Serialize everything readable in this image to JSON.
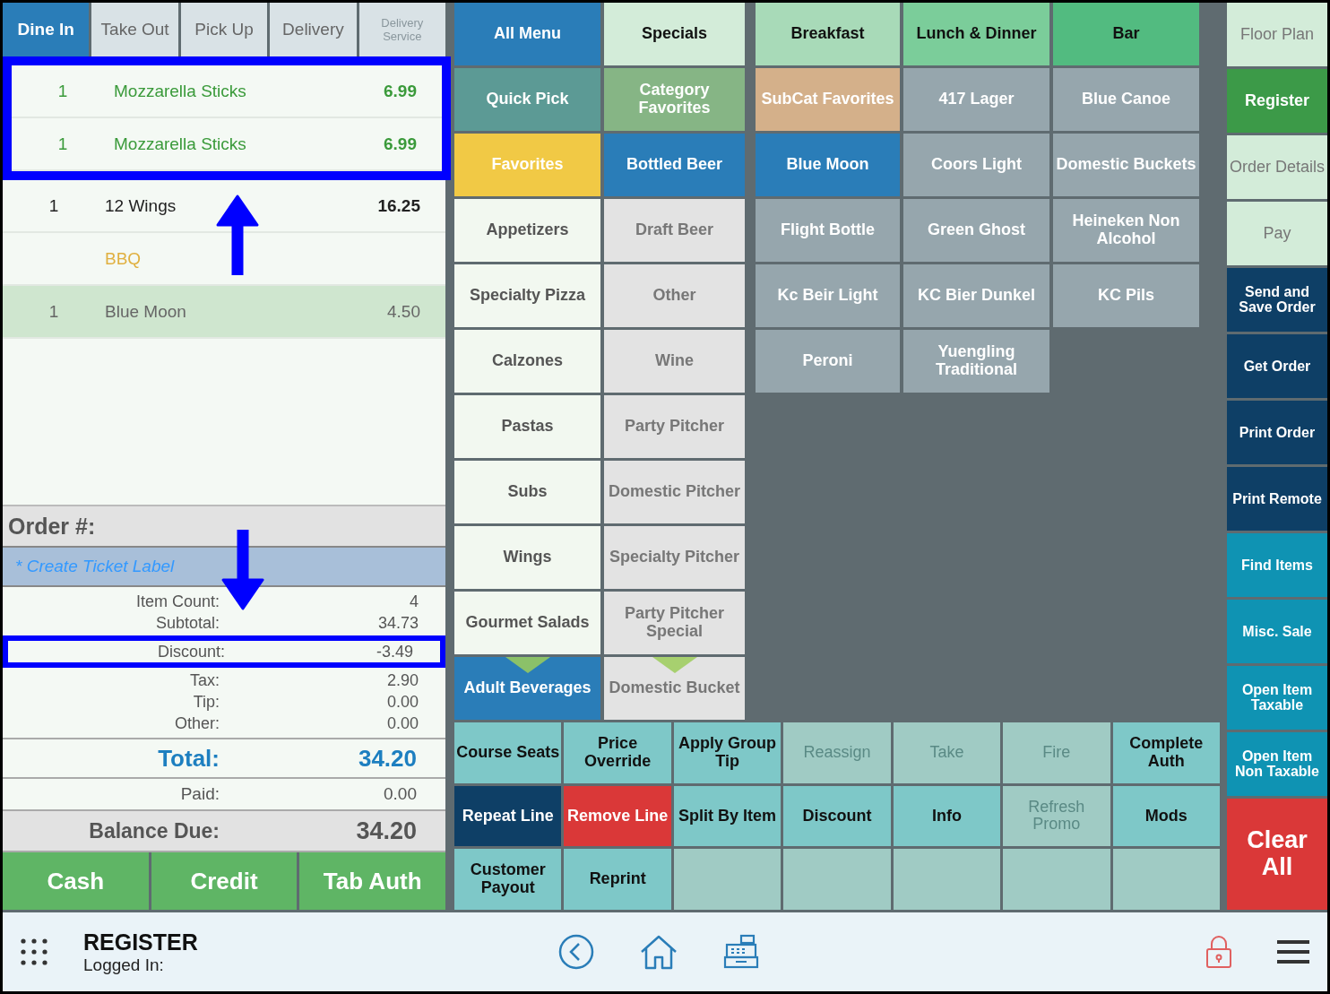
{
  "order_types": [
    {
      "label": "Dine In",
      "selected": true,
      "disabled": false
    },
    {
      "label": "Take Out",
      "selected": false,
      "disabled": false
    },
    {
      "label": "Pick Up",
      "selected": false,
      "disabled": false
    },
    {
      "label": "Delivery",
      "selected": false,
      "disabled": false
    },
    {
      "label": "Delivery Service",
      "selected": false,
      "disabled": true
    }
  ],
  "order_lines": [
    {
      "qty": "1",
      "name": "Mozzarella Sticks",
      "price": "6.99",
      "kind": "sent",
      "selected": false,
      "highlighted": true
    },
    {
      "qty": "1",
      "name": "Mozzarella Sticks",
      "price": "6.99",
      "kind": "sent",
      "selected": false,
      "highlighted": true
    },
    {
      "qty": "1",
      "name": "12 Wings",
      "price": "16.25",
      "kind": "new",
      "selected": false,
      "highlighted": false
    },
    {
      "name": "BBQ",
      "kind": "modifier",
      "selected": false,
      "highlighted": false
    },
    {
      "qty": "1",
      "name": "Blue Moon",
      "price": "4.50",
      "kind": "new",
      "selected": true,
      "highlighted": false
    }
  ],
  "order_number_label": "Order #:",
  "ticket_label": "* Create Ticket Label",
  "summary": [
    {
      "label": "Item Count:",
      "value": "4",
      "highlighted": false
    },
    {
      "label": "Subtotal:",
      "value": "34.73",
      "highlighted": false
    },
    {
      "label": "Discount:",
      "value": "-3.49",
      "highlighted": true
    },
    {
      "label": "Tax:",
      "value": "2.90",
      "highlighted": false
    },
    {
      "label": "Tip:",
      "value": "0.00",
      "highlighted": false
    },
    {
      "label": "Other:",
      "value": "0.00",
      "highlighted": false
    }
  ],
  "total": {
    "label": "Total:",
    "value": "34.20"
  },
  "paid": {
    "label": "Paid:",
    "value": "0.00"
  },
  "balance_due": {
    "label": "Balance Due:",
    "value": "34.20"
  },
  "payment_buttons": [
    "Cash",
    "Credit",
    "Tab Auth"
  ],
  "annotation_arrows": [
    {
      "kind": "up"
    },
    {
      "kind": "down"
    }
  ],
  "menu_tabs": [
    {
      "label": "All Menu",
      "color": "#2a7db8",
      "selected": true
    },
    {
      "label": "Specials",
      "color": "#d3ecd9",
      "selected": false
    },
    {
      "label": "Breakfast",
      "color": "#a8dab8",
      "selected": false
    },
    {
      "label": "Lunch & Dinner",
      "color": "#7bcd9a",
      "selected": false
    },
    {
      "label": "Bar",
      "color": "#52bb80",
      "selected": false
    }
  ],
  "categories": [
    {
      "label": "Quick Pick",
      "kind": "shortcut",
      "selected": false,
      "more_below": false
    },
    {
      "label": "Favorites",
      "kind": "favorite",
      "selected": false,
      "more_below": false
    },
    {
      "label": "Appetizers",
      "kind": "category",
      "selected": false,
      "more_below": false
    },
    {
      "label": "Specialty Pizza",
      "kind": "category",
      "selected": false,
      "more_below": false
    },
    {
      "label": "Calzones",
      "kind": "category",
      "selected": false,
      "more_below": false
    },
    {
      "label": "Pastas",
      "kind": "category",
      "selected": false,
      "more_below": false
    },
    {
      "label": "Subs",
      "kind": "category",
      "selected": false,
      "more_below": false
    },
    {
      "label": "Wings",
      "kind": "category",
      "selected": false,
      "more_below": false
    },
    {
      "label": "Gourmet Salads",
      "kind": "category",
      "selected": false,
      "more_below": false
    },
    {
      "label": "Adult Beverages",
      "kind": "category",
      "selected": true,
      "more_below": true
    }
  ],
  "subcategories": [
    {
      "label": "Category Favorites",
      "kind": "group",
      "selected": false,
      "more_below": false
    },
    {
      "label": "Bottled Beer",
      "kind": "subcategory",
      "selected": true,
      "more_below": false
    },
    {
      "label": "Draft Beer",
      "kind": "subcategory",
      "selected": false,
      "more_below": false
    },
    {
      "label": "Other",
      "kind": "subcategory",
      "selected": false,
      "more_below": false
    },
    {
      "label": "Wine",
      "kind": "subcategory",
      "selected": false,
      "more_below": false
    },
    {
      "label": "Party Pitcher",
      "kind": "subcategory",
      "selected": false,
      "more_below": false
    },
    {
      "label": "Domestic Pitcher",
      "kind": "subcategory",
      "selected": false,
      "more_below": false
    },
    {
      "label": "Specialty Pitcher",
      "kind": "subcategory",
      "selected": false,
      "more_below": false
    },
    {
      "label": "Party Pitcher Special",
      "kind": "subcategory",
      "selected": false,
      "more_below": false
    },
    {
      "label": "Domestic Bucket",
      "kind": "subcategory",
      "selected": false,
      "more_below": true
    }
  ],
  "items": [
    {
      "label": "SubCat Favorites",
      "kind": "subgroup",
      "selected": false
    },
    {
      "label": "417 Lager",
      "kind": "product",
      "selected": false
    },
    {
      "label": "Blue Canoe",
      "kind": "product",
      "selected": false
    },
    {
      "label": "Blue Moon",
      "kind": "product",
      "selected": true
    },
    {
      "label": "Coors Light",
      "kind": "product",
      "selected": false
    },
    {
      "label": "Domestic Buckets",
      "kind": "product",
      "selected": false
    },
    {
      "label": "Flight Bottle",
      "kind": "product",
      "selected": false
    },
    {
      "label": "Green Ghost",
      "kind": "product",
      "selected": false
    },
    {
      "label": "Heineken Non Alcohol",
      "kind": "product",
      "selected": false
    },
    {
      "label": "Kc Beir Light",
      "kind": "product",
      "selected": false
    },
    {
      "label": "KC Bier Dunkel",
      "kind": "product",
      "selected": false
    },
    {
      "label": "KC Pils",
      "kind": "product",
      "selected": false
    },
    {
      "label": "Peroni",
      "kind": "product",
      "selected": false
    },
    {
      "label": "Yuengling Traditional",
      "kind": "product",
      "selected": false
    }
  ],
  "actions": [
    {
      "label": "Course Seats",
      "kind": "action",
      "disabled": false
    },
    {
      "label": "Price Override",
      "kind": "action",
      "disabled": false
    },
    {
      "label": "Apply Group Tip",
      "kind": "action",
      "disabled": false
    },
    {
      "label": "Reassign",
      "kind": "action",
      "disabled": true
    },
    {
      "label": "Take",
      "kind": "action",
      "disabled": true
    },
    {
      "label": "Fire",
      "kind": "action",
      "disabled": true
    },
    {
      "label": "Complete Auth",
      "kind": "action",
      "disabled": false
    },
    {
      "label": "Repeat Line",
      "kind": "dark",
      "disabled": false
    },
    {
      "label": "Remove Line",
      "kind": "danger",
      "disabled": false
    },
    {
      "label": "Split By Item",
      "kind": "action",
      "disabled": false
    },
    {
      "label": "Discount",
      "kind": "action",
      "disabled": false
    },
    {
      "label": "Info",
      "kind": "action",
      "disabled": false
    },
    {
      "label": "Refresh Promo",
      "kind": "action",
      "disabled": true
    },
    {
      "label": "Mods",
      "kind": "action",
      "disabled": false
    },
    {
      "label": "Customer Payout",
      "kind": "action",
      "disabled": false
    },
    {
      "label": "Reprint",
      "kind": "action",
      "disabled": false
    },
    {
      "kind": "empty"
    },
    {
      "kind": "empty"
    },
    {
      "kind": "empty"
    },
    {
      "kind": "empty"
    },
    {
      "kind": "empty"
    }
  ],
  "side_nav": [
    {
      "label": "Floor Plan",
      "kind": "nav",
      "selected": false
    },
    {
      "label": "Register",
      "kind": "nav",
      "selected": true
    },
    {
      "label": "Order Details",
      "kind": "nav",
      "selected": false
    },
    {
      "label": "Pay",
      "kind": "nav",
      "selected": false
    },
    {
      "label": "Send and Save Order",
      "kind": "order",
      "selected": false
    },
    {
      "label": "Get Order",
      "kind": "order",
      "selected": false
    },
    {
      "label": "Print Order",
      "kind": "order",
      "selected": false
    },
    {
      "label": "Print Remote",
      "kind": "order",
      "selected": false
    },
    {
      "label": "Find Items",
      "kind": "tool",
      "selected": false
    },
    {
      "label": "Misc. Sale",
      "kind": "tool",
      "selected": false
    },
    {
      "label": "Open Item Taxable",
      "kind": "tool",
      "selected": false
    },
    {
      "label": "Open Item Non Taxable",
      "kind": "tool",
      "selected": false
    },
    {
      "label": "Clear All",
      "kind": "clear",
      "selected": false
    }
  ],
  "footer": {
    "title": "REGISTER",
    "subtitle": "Logged In:"
  }
}
